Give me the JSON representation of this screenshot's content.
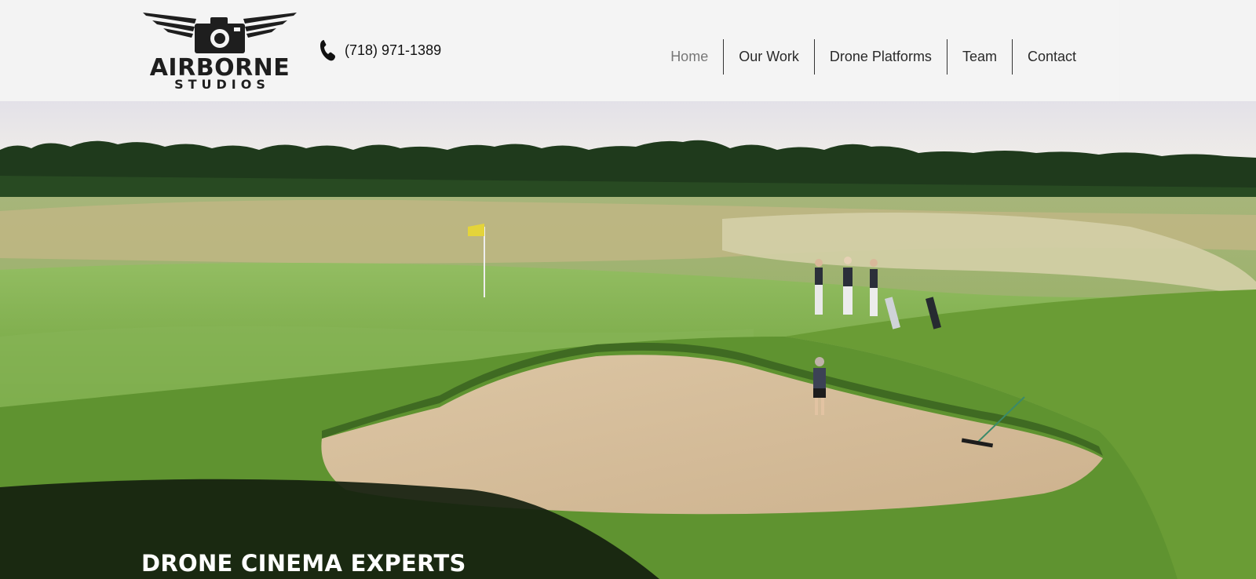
{
  "brand": {
    "name_line1": "AIRBORNE",
    "name_line2": "STUDIOS",
    "logo_icon": "winged-camera-logo"
  },
  "contact": {
    "phone_icon": "phone-icon",
    "phone": "(718) 971-1389"
  },
  "nav": {
    "items": [
      {
        "label": "Home",
        "active": true
      },
      {
        "label": "Our Work"
      },
      {
        "label": "Drone Platforms"
      },
      {
        "label": "Team"
      },
      {
        "label": "Contact"
      }
    ]
  },
  "hero": {
    "tagline": "DRONE CINEMA EXPERTS"
  }
}
